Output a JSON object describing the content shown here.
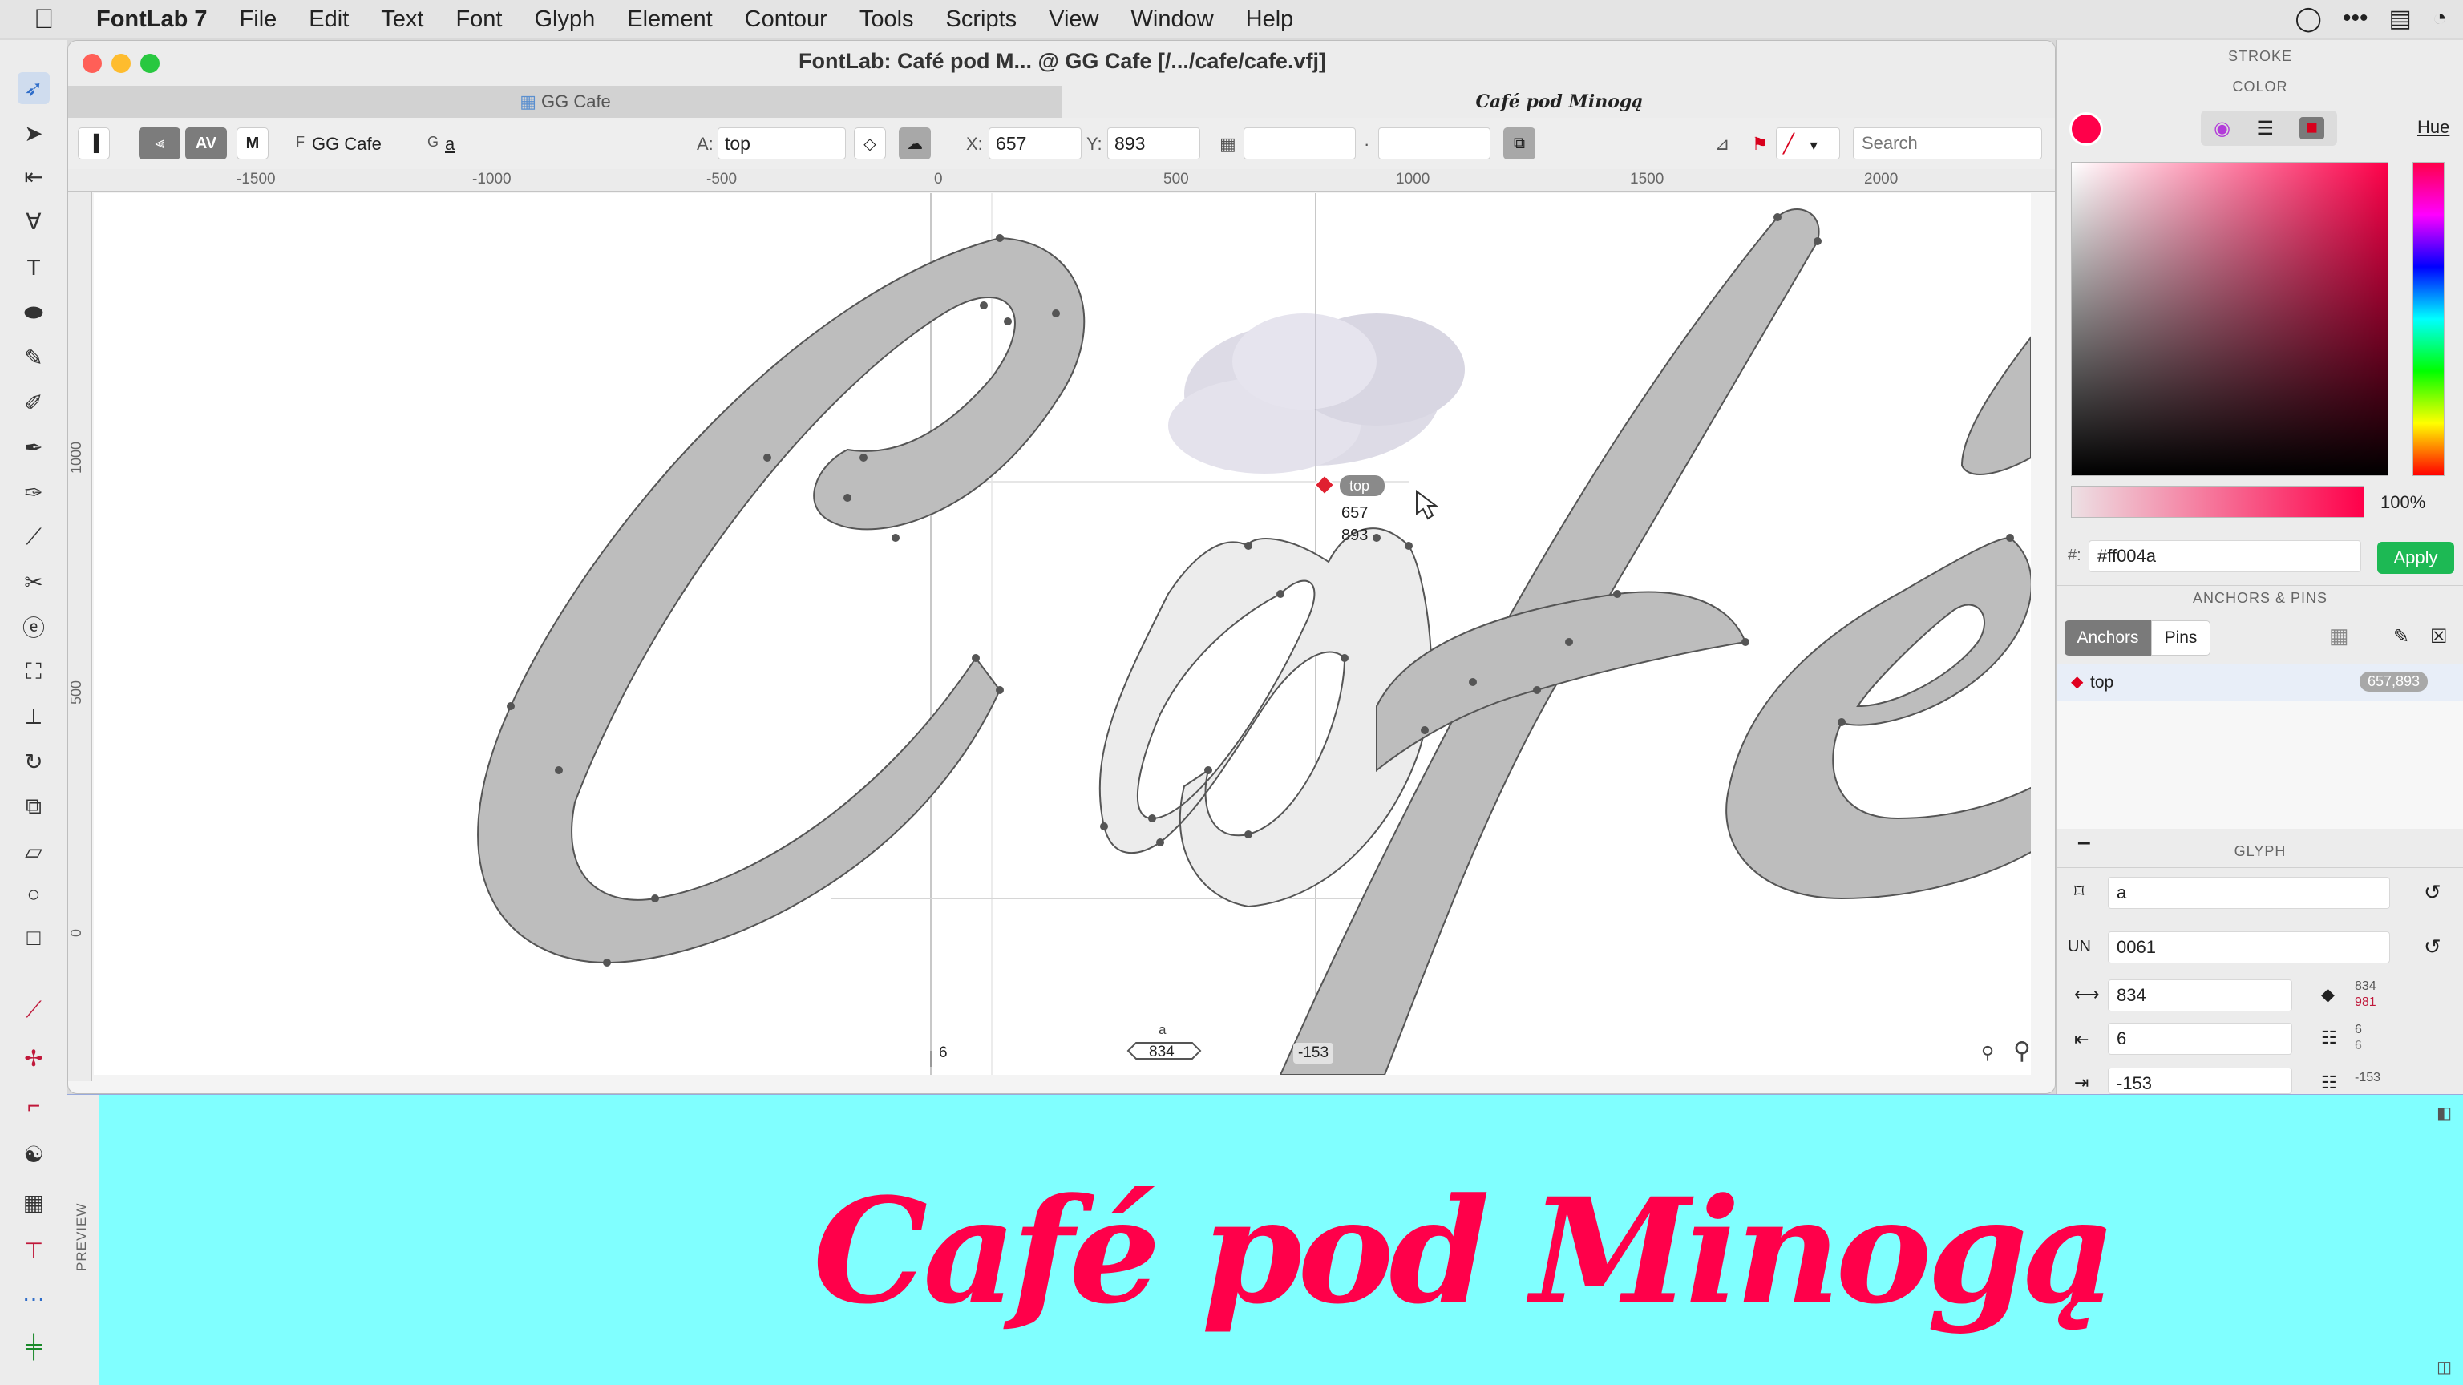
{
  "menubar": {
    "app": "FontLab 7",
    "items": [
      "File",
      "Edit",
      "Text",
      "Font",
      "Glyph",
      "Element",
      "Contour",
      "Tools",
      "Scripts",
      "View",
      "Window",
      "Help"
    ]
  },
  "window": {
    "title": "FontLab: Café pod M... @ GG Cafe  [/.../cafe/cafe.vfj]",
    "tabs": [
      "GG Cafe",
      "Café pod Minogą"
    ]
  },
  "glyphbar": {
    "font_prefix": "F",
    "font_name": "GG Cafe",
    "glyph_prefix": "G",
    "glyph_name": "a",
    "anchor_label": "A:",
    "anchor_value": "top",
    "x_label": "X:",
    "x_value": "657",
    "y_label": "Y:",
    "y_value": "893",
    "dot": "·",
    "search_placeholder": "Search"
  },
  "ruler": {
    "labels": [
      "-1500",
      "-1000",
      "-500",
      "0",
      "500",
      "1000",
      "1500",
      "2000"
    ],
    "vlabels": [
      "1000",
      "500",
      "0"
    ]
  },
  "canvas": {
    "anchor_tag": "top",
    "anchor_x": "657",
    "anchor_y": "893",
    "glyph_name": "a",
    "lsb": "6",
    "advance": "834",
    "rsb": "-153"
  },
  "panel": {
    "stroke_label": "STROKE",
    "color_label": "COLOR",
    "hue_label": "Hue",
    "opacity": "100%",
    "hex_label": "#:",
    "hex_value": "#ff004a",
    "apply_label": "Apply",
    "anchors_pins_label": "ANCHORS & PINS",
    "anchors_tab": "Anchors",
    "pins_tab": "Pins",
    "anchor_item_name": "top",
    "anchor_item_coords": "657,893",
    "minus": "–",
    "glyph_label": "GLYPH",
    "glyph_name": "a",
    "un_label": "UN",
    "unicode": "0061",
    "width": "834",
    "width_sub1": "834",
    "width_sub2": "981",
    "lsb": "6",
    "lsb_sub1": "6",
    "lsb_sub2": "6",
    "rsb": "-153",
    "rsb_sub1": "-153"
  },
  "preview": {
    "label": "PREVIEW",
    "text": "Café pod Minogą"
  },
  "colors": {
    "accent": "#ff004a",
    "preview_bg": "#80ffff",
    "apply": "#1db954",
    "glyph_fill": "#bdbdbd",
    "glyph_active_fill": "#ececec"
  }
}
